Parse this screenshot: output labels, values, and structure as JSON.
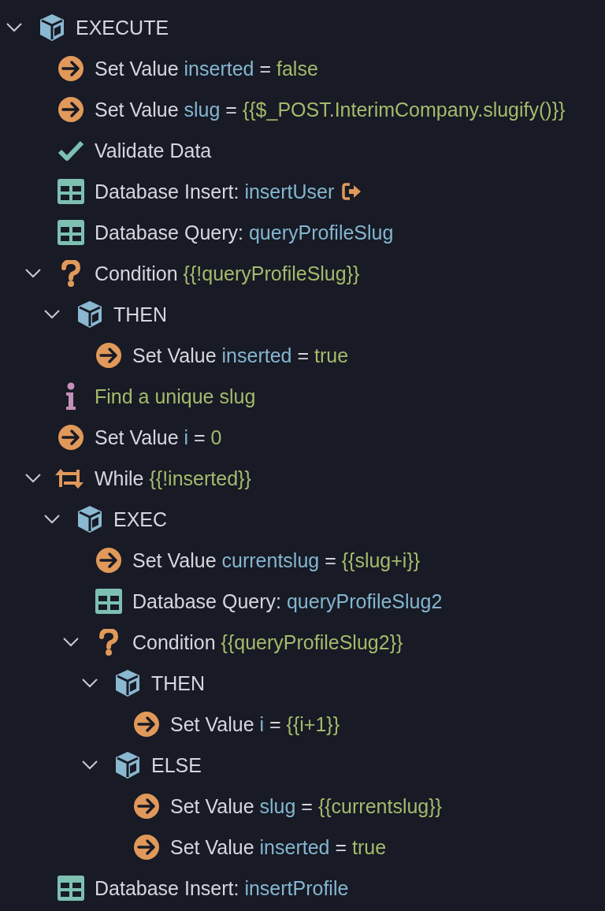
{
  "tree": [
    {
      "kind": "block",
      "expanded": true,
      "parts": [
        {
          "kind": "text",
          "text": "EXECUTE"
        }
      ],
      "children": [
        {
          "kind": "action",
          "parts": [
            {
              "kind": "text",
              "text": "Set Value"
            },
            {
              "kind": "variable",
              "text": "inserted"
            },
            {
              "kind": "text",
              "text": "="
            },
            {
              "kind": "value",
              "text": "false"
            }
          ]
        },
        {
          "kind": "action",
          "parts": [
            {
              "kind": "text",
              "text": "Set Value"
            },
            {
              "kind": "variable",
              "text": "slug"
            },
            {
              "kind": "text",
              "text": "="
            },
            {
              "kind": "value",
              "text": "{{$_POST.InterimCompany.slugify()}}"
            }
          ]
        },
        {
          "kind": "validate",
          "parts": [
            {
              "kind": "text",
              "text": "Validate Data"
            }
          ]
        },
        {
          "kind": "database",
          "linked": true,
          "parts": [
            {
              "kind": "text",
              "text": "Database Insert:"
            },
            {
              "kind": "variable",
              "text": "insertUser"
            }
          ]
        },
        {
          "kind": "database",
          "parts": [
            {
              "kind": "text",
              "text": "Database Query:"
            },
            {
              "kind": "variable",
              "text": "queryProfileSlug"
            }
          ]
        },
        {
          "kind": "condition",
          "expanded": true,
          "parts": [
            {
              "kind": "text",
              "text": "Condition"
            },
            {
              "kind": "value",
              "text": "{{!queryProfileSlug}}"
            }
          ],
          "children": [
            {
              "kind": "block",
              "expanded": true,
              "parts": [
                {
                  "kind": "text",
                  "text": "THEN"
                }
              ],
              "children": [
                {
                  "kind": "action",
                  "parts": [
                    {
                      "kind": "text",
                      "text": "Set Value"
                    },
                    {
                      "kind": "variable",
                      "text": "inserted"
                    },
                    {
                      "kind": "text",
                      "text": "="
                    },
                    {
                      "kind": "value",
                      "text": "true"
                    }
                  ]
                }
              ]
            }
          ]
        },
        {
          "kind": "comment",
          "parts": [
            {
              "kind": "value",
              "text": "Find a unique slug"
            }
          ]
        },
        {
          "kind": "action",
          "parts": [
            {
              "kind": "text",
              "text": "Set Value"
            },
            {
              "kind": "variable",
              "text": "i"
            },
            {
              "kind": "text",
              "text": "="
            },
            {
              "kind": "value",
              "text": "0"
            }
          ]
        },
        {
          "kind": "loop",
          "expanded": true,
          "parts": [
            {
              "kind": "text",
              "text": "While"
            },
            {
              "kind": "value",
              "text": "{{!inserted}}"
            }
          ],
          "children": [
            {
              "kind": "block",
              "expanded": true,
              "parts": [
                {
                  "kind": "text",
                  "text": "EXEC"
                }
              ],
              "children": [
                {
                  "kind": "action",
                  "parts": [
                    {
                      "kind": "text",
                      "text": "Set Value"
                    },
                    {
                      "kind": "variable",
                      "text": "currentslug"
                    },
                    {
                      "kind": "text",
                      "text": "="
                    },
                    {
                      "kind": "value",
                      "text": "{{slug+i}}"
                    }
                  ]
                },
                {
                  "kind": "database",
                  "parts": [
                    {
                      "kind": "text",
                      "text": "Database Query:"
                    },
                    {
                      "kind": "variable",
                      "text": "queryProfileSlug2"
                    }
                  ]
                },
                {
                  "kind": "condition",
                  "expanded": true,
                  "parts": [
                    {
                      "kind": "text",
                      "text": "Condition"
                    },
                    {
                      "kind": "value",
                      "text": "{{queryProfileSlug2}}"
                    }
                  ],
                  "children": [
                    {
                      "kind": "block",
                      "expanded": true,
                      "parts": [
                        {
                          "kind": "text",
                          "text": "THEN"
                        }
                      ],
                      "children": [
                        {
                          "kind": "action",
                          "parts": [
                            {
                              "kind": "text",
                              "text": "Set Value"
                            },
                            {
                              "kind": "variable",
                              "text": "i"
                            },
                            {
                              "kind": "text",
                              "text": "="
                            },
                            {
                              "kind": "value",
                              "text": "{{i+1}}"
                            }
                          ]
                        }
                      ]
                    },
                    {
                      "kind": "block",
                      "expanded": true,
                      "parts": [
                        {
                          "kind": "text",
                          "text": "ELSE"
                        }
                      ],
                      "children": [
                        {
                          "kind": "action",
                          "parts": [
                            {
                              "kind": "text",
                              "text": "Set Value"
                            },
                            {
                              "kind": "variable",
                              "text": "slug"
                            },
                            {
                              "kind": "text",
                              "text": "="
                            },
                            {
                              "kind": "value",
                              "text": "{{currentslug}}"
                            }
                          ]
                        },
                        {
                          "kind": "action",
                          "parts": [
                            {
                              "kind": "text",
                              "text": "Set Value"
                            },
                            {
                              "kind": "variable",
                              "text": "inserted"
                            },
                            {
                              "kind": "text",
                              "text": "="
                            },
                            {
                              "kind": "value",
                              "text": "true"
                            }
                          ]
                        }
                      ]
                    }
                  ]
                }
              ]
            }
          ]
        },
        {
          "kind": "database",
          "parts": [
            {
              "kind": "text",
              "text": "Database Insert:"
            },
            {
              "kind": "variable",
              "text": "insertProfile"
            }
          ]
        }
      ]
    }
  ]
}
